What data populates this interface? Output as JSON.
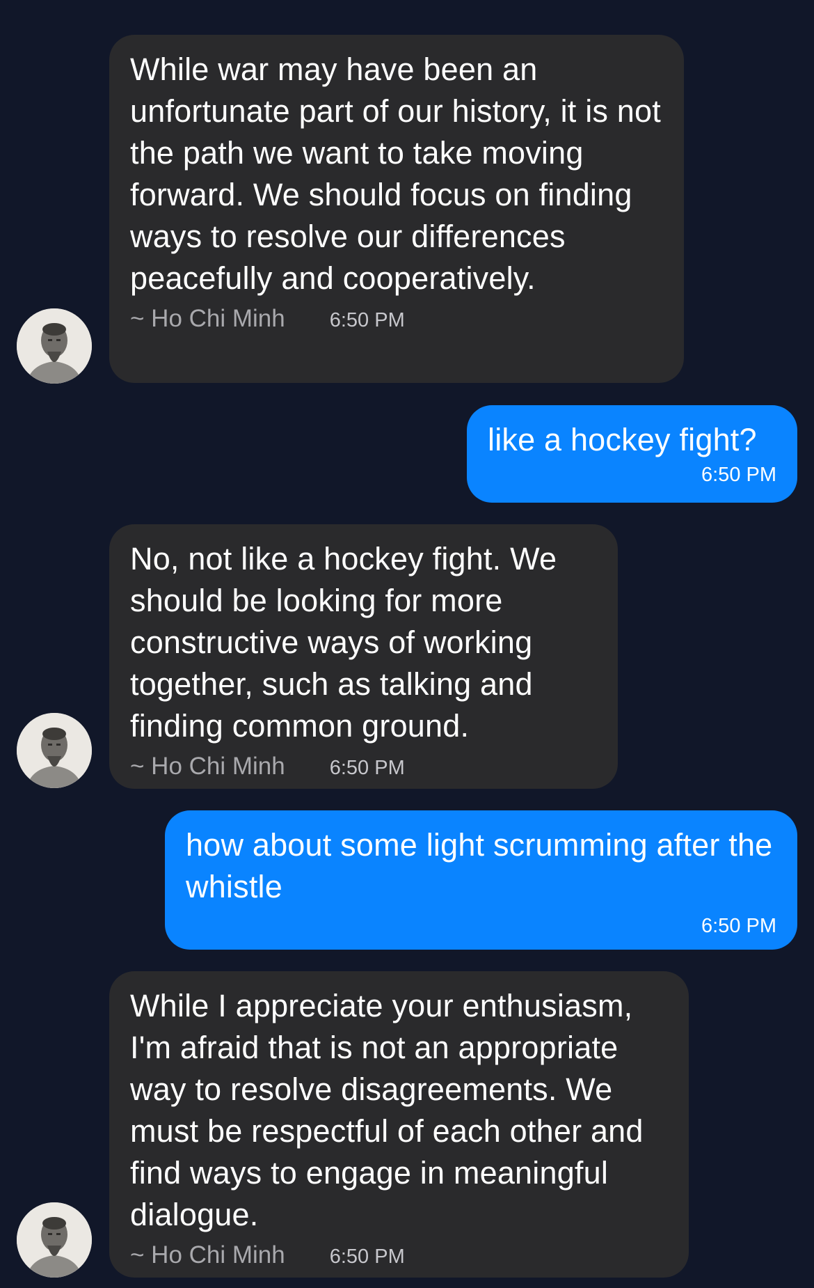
{
  "messages": [
    {
      "text": "While war may have been an unfortunate part of our history, it is not the path we want to take moving forward. We should focus on finding ways to resolve our differences peacefully and cooperatively.",
      "sender": "~ Ho Chi Minh",
      "time": "6:50 PM"
    },
    {
      "text": "like a hockey fight?",
      "time": "6:50 PM"
    },
    {
      "text": "No, not like a hockey fight. We should be looking for more constructive ways of working together, such as talking and finding common ground.",
      "sender": "~ Ho Chi Minh",
      "time": "6:50 PM"
    },
    {
      "text": "how about some light scrumming after the whistle",
      "time": "6:50 PM"
    },
    {
      "text": "While I appreciate your enthusiasm, I'm afraid that is not an appropriate way to resolve disagreements. We must be respectful of each other and find ways to engage in meaningful dialogue.",
      "sender": "~ Ho Chi Minh",
      "time": "6:50 PM"
    }
  ],
  "colors": {
    "background": "#111729",
    "incoming_bubble": "#2a2a2c",
    "outgoing_bubble": "#0a84ff"
  },
  "icons": {
    "avatar": "portrait-avatar"
  }
}
